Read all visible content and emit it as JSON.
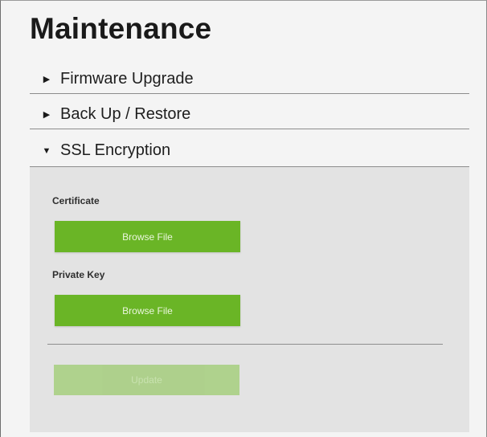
{
  "page": {
    "title": "Maintenance"
  },
  "sections": [
    {
      "label": "Firmware Upgrade",
      "expanded": false,
      "icon": "triangle-right-icon"
    },
    {
      "label": "Back Up / Restore",
      "expanded": false,
      "icon": "triangle-right-icon"
    },
    {
      "label": "SSL Encryption",
      "expanded": true,
      "icon": "triangle-down-icon"
    }
  ],
  "ssl": {
    "certificate_label": "Certificate",
    "certificate_button": "Browse File",
    "private_key_label": "Private Key",
    "private_key_button": "Browse File",
    "update_button": "Update",
    "update_enabled": false
  },
  "icons": {
    "collapsed": "▶",
    "expanded": "▼"
  },
  "colors": {
    "accent": "#6ab526",
    "accent_disabled": "#a9cf83",
    "panel_bg": "#e3e3e3"
  }
}
